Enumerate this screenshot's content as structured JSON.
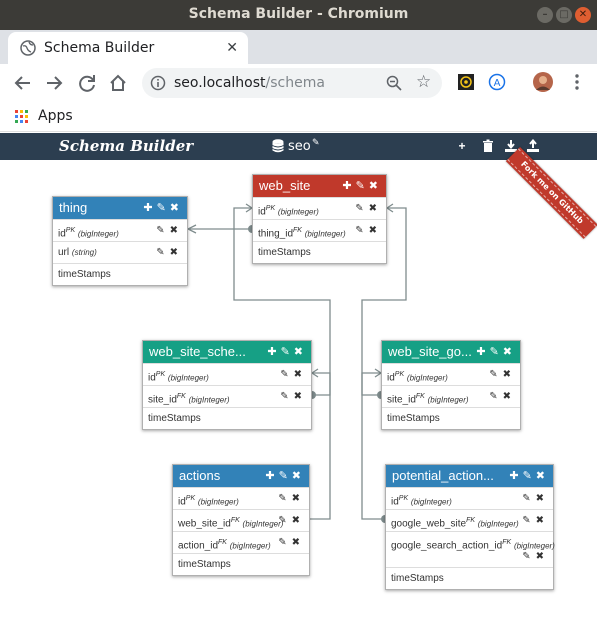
{
  "window": {
    "title": "Schema Builder - Chromium"
  },
  "tab": {
    "title": "Schema Builder",
    "close_glyph": "✕",
    "new_tab_glyph": "+"
  },
  "omnibox": {
    "host": "seo.localhost",
    "path": "/schema"
  },
  "bookmarks": {
    "apps_label": "Apps"
  },
  "app": {
    "brand": "Schema Builder",
    "db_name": "seo",
    "ribbon": "Fork me on GitHub",
    "nav_icons": [
      "plus-icon",
      "trash-icon",
      "download-icon",
      "upload-icon"
    ]
  },
  "tables": [
    {
      "name": "thing",
      "color": "#3282b8",
      "fields": [
        {
          "name": "id",
          "key": "PK",
          "type": "(bigInteger)"
        },
        {
          "name": "url",
          "key": "",
          "type": "(string)"
        }
      ],
      "footer": "timeStamps"
    },
    {
      "name": "web_site",
      "color": "#c0392b",
      "fields": [
        {
          "name": "id",
          "key": "PK",
          "type": "(bigInteger)"
        },
        {
          "name": "thing_id",
          "key": "FK",
          "type": "(bigInteger)"
        }
      ],
      "footer": "timeStamps"
    },
    {
      "name": "web_site_sche...",
      "color": "#16a085",
      "fields": [
        {
          "name": "id",
          "key": "PK",
          "type": "(bigInteger)"
        },
        {
          "name": "site_id",
          "key": "FK",
          "type": "(bigInteger)"
        }
      ],
      "footer": "timeStamps"
    },
    {
      "name": "web_site_go...",
      "color": "#16a085",
      "fields": [
        {
          "name": "id",
          "key": "PK",
          "type": "(bigInteger)"
        },
        {
          "name": "site_id",
          "key": "FK",
          "type": "(bigInteger)"
        }
      ],
      "footer": "timeStamps"
    },
    {
      "name": "actions",
      "color": "#3282b8",
      "fields": [
        {
          "name": "id",
          "key": "PK",
          "type": "(bigInteger)"
        },
        {
          "name": "web_site_id",
          "key": "FK",
          "type": "(bigInteger)"
        },
        {
          "name": "action_id",
          "key": "FK",
          "type": "(bigInteger)"
        }
      ],
      "footer": "timeStamps"
    },
    {
      "name": "potential_action...",
      "color": "#3282b8",
      "fields": [
        {
          "name": "id",
          "key": "PK",
          "type": "(bigInteger)"
        },
        {
          "name": "google_web_site",
          "key": "FK",
          "type": "(bigInteger)"
        },
        {
          "name": "google_search_action_id",
          "key": "FK",
          "type": "(bigInteger)"
        }
      ],
      "footer": "timeStamps"
    }
  ]
}
